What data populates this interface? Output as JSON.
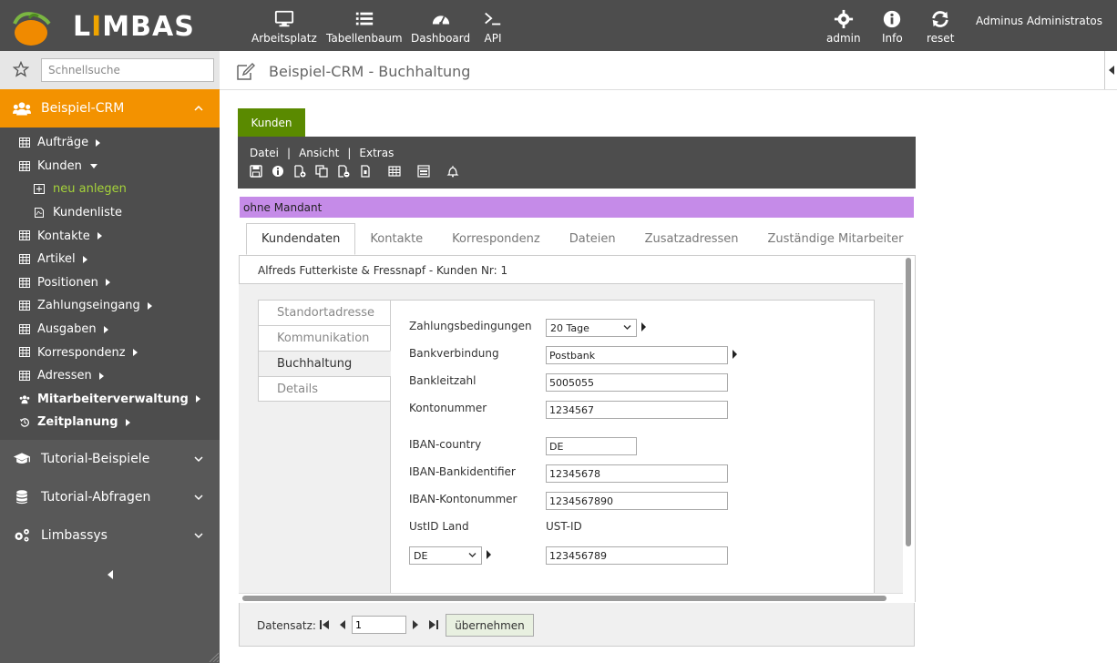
{
  "app": {
    "logo_text_prefix": "L",
    "logo_text_accent": "I",
    "logo_text_suffix": "MBAS",
    "user_name": "Adminus Administratos"
  },
  "topnav": [
    {
      "label": "Arbeitsplatz",
      "icon": "monitor-icon"
    },
    {
      "label": "Tabellenbaum",
      "icon": "list-icon"
    },
    {
      "label": "Dashboard",
      "icon": "dashboard-icon"
    },
    {
      "label": "API",
      "icon": "terminal-icon"
    },
    {
      "label": "admin",
      "icon": "gear-icon"
    },
    {
      "label": "Info",
      "icon": "info-icon"
    },
    {
      "label": "reset",
      "icon": "refresh-icon"
    }
  ],
  "sidebar": {
    "search_placeholder": "Schnellsuche",
    "groups": {
      "crm": "Beispiel-CRM",
      "tutorial_beispiele": "Tutorial-Beispiele",
      "tutorial_abfragen": "Tutorial-Abfragen",
      "limbassys": "Limbassys"
    },
    "items": [
      {
        "label": "Aufträge"
      },
      {
        "label": "Kunden"
      },
      {
        "label": "neu anlegen"
      },
      {
        "label": "Kundenliste"
      },
      {
        "label": "Kontakte"
      },
      {
        "label": "Artikel"
      },
      {
        "label": "Positionen"
      },
      {
        "label": "Zahlungseingang"
      },
      {
        "label": "Ausgaben"
      },
      {
        "label": "Korrespondenz"
      },
      {
        "label": "Adressen"
      },
      {
        "label": "Mitarbeiterverwaltung"
      },
      {
        "label": "Zeitplanung"
      }
    ]
  },
  "header": {
    "title": "Beispiel-CRM - Buchhaltung"
  },
  "form": {
    "table_tab": "Kunden",
    "menu": [
      "Datei",
      "Ansicht",
      "Extras"
    ],
    "menu_separator": "|",
    "mandant": "ohne Mandant",
    "tabs": [
      "Kundendaten",
      "Kontakte",
      "Korrespondenz",
      "Dateien",
      "Zusatzadressen",
      "Zuständige Mitarbeiter"
    ],
    "record_title": "Alfreds Futterkiste & Fressnapf - Kunden Nr: 1",
    "subtabs": [
      "Standortadresse",
      "Kommunikation",
      "Buchhaltung",
      "Details"
    ],
    "fields": {
      "zahlungsbedingungen": {
        "label": "Zahlungsbedingungen",
        "value": "20 Tage"
      },
      "bankverbindung": {
        "label": "Bankverbindung",
        "value": "Postbank"
      },
      "bankleitzahl": {
        "label": "Bankleitzahl",
        "value": "5005055"
      },
      "kontonummer": {
        "label": "Kontonummer",
        "value": "1234567"
      },
      "iban_country": {
        "label": "IBAN-country",
        "value": "DE"
      },
      "iban_bankidentifier": {
        "label": "IBAN-Bankidentifier",
        "value": "12345678"
      },
      "iban_kontonummer": {
        "label": "IBAN-Kontonummer",
        "value": "1234567890"
      },
      "ustid_land": {
        "label": "UstID Land",
        "value": "DE"
      },
      "ustid": {
        "label": "UST-ID",
        "value": "123456789"
      }
    }
  },
  "footer": {
    "label": "Datensatz:",
    "record_value": "1",
    "apply_label": "übernehmen"
  },
  "colors": {
    "topbar": "#4d4d4d",
    "sidebar": "#585858",
    "crm_accent": "#f39200",
    "table_tab": "#5a8a00",
    "mandant_bar": "#c58be8",
    "active_link": "#a5d33a"
  }
}
